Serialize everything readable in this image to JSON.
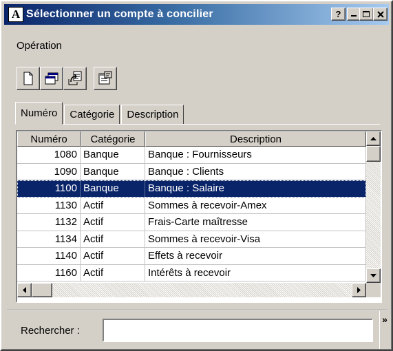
{
  "window": {
    "title": "Sélectionner un compte à concilier",
    "app_icon_letter": "A",
    "help_label": "?"
  },
  "menu": {
    "items": [
      "Opération"
    ]
  },
  "toolbar": {
    "buttons": [
      "new-document-icon",
      "duplicate-windows-icon",
      "export-icon",
      "properties-icon"
    ]
  },
  "tabs": [
    {
      "label": "Numéro",
      "active": true
    },
    {
      "label": "Catégorie",
      "active": false
    },
    {
      "label": "Description",
      "active": false
    }
  ],
  "table": {
    "columns": [
      "Numéro",
      "Catégorie",
      "Description"
    ],
    "rows": [
      {
        "num": "1080",
        "cat": "Banque",
        "desc": "Banque : Fournisseurs",
        "selected": false
      },
      {
        "num": "1090",
        "cat": "Banque",
        "desc": "Banque : Clients",
        "selected": false
      },
      {
        "num": "1100",
        "cat": "Banque",
        "desc": "Banque : Salaire",
        "selected": true
      },
      {
        "num": "1130",
        "cat": "Actif",
        "desc": "Sommes à recevoir-Amex",
        "selected": false
      },
      {
        "num": "1132",
        "cat": "Actif",
        "desc": "Frais-Carte maîtresse",
        "selected": false
      },
      {
        "num": "1134",
        "cat": "Actif",
        "desc": "Sommes à recevoir-Visa",
        "selected": false
      },
      {
        "num": "1140",
        "cat": "Actif",
        "desc": "Effets à recevoir",
        "selected": false
      },
      {
        "num": "1160",
        "cat": "Actif",
        "desc": "Intérêts à recevoir",
        "selected": false
      }
    ]
  },
  "search": {
    "label": "Rechercher :",
    "value": "",
    "expand_glyph": "»"
  },
  "colors": {
    "title_bar": "#0a246a",
    "selection": "#0a246a",
    "face": "#d4d0c8"
  }
}
